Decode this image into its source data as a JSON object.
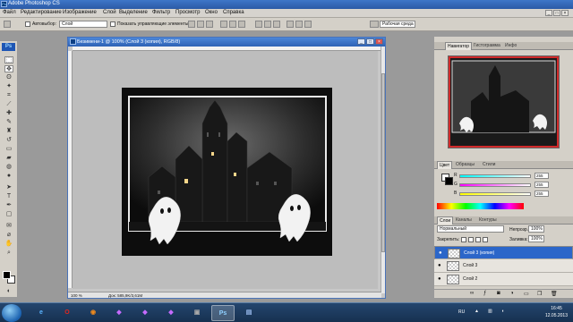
{
  "app": {
    "title": "Adobe Photoshop CS"
  },
  "menu": [
    "Файл",
    "Редактирование",
    "Изображение",
    "Слой",
    "Выделение",
    "Фильтр",
    "Просмотр",
    "Окно",
    "Справка"
  ],
  "options": {
    "autoselect_label": "Автовыбор:",
    "autoselect_value": "Слой",
    "show_controls_label": "Показать управляющие элементы",
    "workspace_label": "Рабочая среда"
  },
  "document": {
    "title": "Безимени-1 @ 100% (Слой 3 (копия), RGB/8)",
    "zoom": "100 %",
    "doc_info": "Док: 585,9K/3,61M"
  },
  "panels": {
    "navigator_tabs": [
      "Навигатор",
      "Гистограмма",
      "Инфо"
    ],
    "color_tabs": [
      "Цвет",
      "Образцы",
      "Стили"
    ],
    "color_channels": [
      {
        "label": "R",
        "value": "255"
      },
      {
        "label": "G",
        "value": "255"
      },
      {
        "label": "B",
        "value": "255"
      }
    ],
    "layers_tabs": [
      "Слои",
      "Каналы",
      "Контуры"
    ],
    "blend_mode": "Нормальный",
    "opacity_label": "Непрозр.:",
    "opacity_value": "100%",
    "lock_label": "Закрепить:",
    "fill_label": "Заливка:",
    "fill_value": "100%",
    "layers": [
      {
        "name": "Слой 3 (копия)",
        "selected": true
      },
      {
        "name": "Слой 3",
        "selected": false
      },
      {
        "name": "Слой 2",
        "selected": false
      }
    ]
  },
  "taskbar": {
    "apps": [
      "ie-icon",
      "opera-icon",
      "firefox-icon",
      "media-icon",
      "ps-icon"
    ],
    "lang": "RU",
    "time": "16:45",
    "date": "12.05.2013"
  },
  "colors": {
    "title_bar": "#2f62b3",
    "selected_layer": "#2b66c9",
    "nav_box": "#d12a2a"
  }
}
